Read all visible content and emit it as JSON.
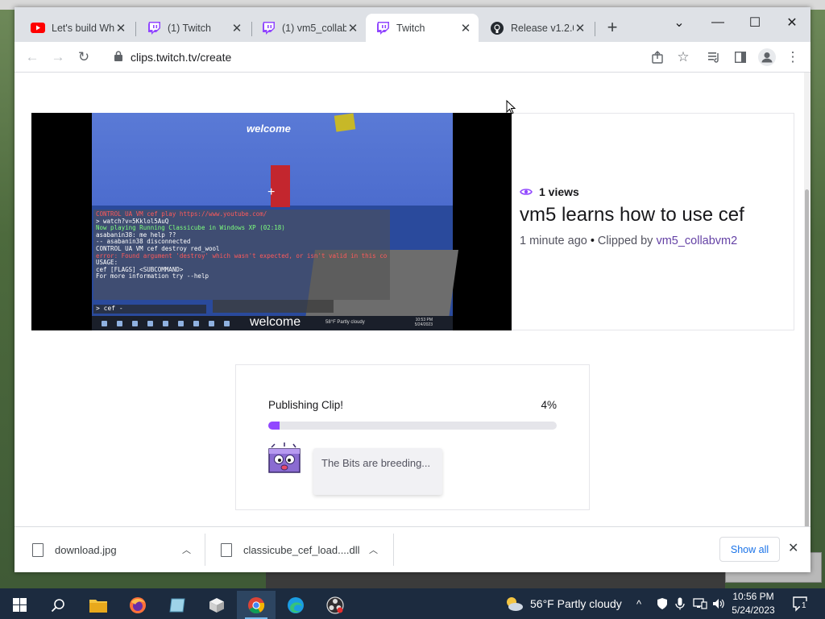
{
  "browser": {
    "tabs": [
      {
        "label": "Let's build Wh",
        "favicon": "youtube-icon",
        "active": false
      },
      {
        "label": "(1) Twitch",
        "favicon": "twitch-icon",
        "active": false
      },
      {
        "label": "(1) vm5_collab",
        "favicon": "twitch-icon",
        "active": false
      },
      {
        "label": "Twitch",
        "favicon": "twitch-icon",
        "active": true
      },
      {
        "label": "Release v1.2.0",
        "favicon": "github-icon",
        "active": false
      }
    ],
    "url": "clips.twitch.tv/create"
  },
  "clip": {
    "views": "1 views",
    "title": "vm5 learns how to use cef",
    "time_ago": "1 minute ago",
    "clipped_by_label": "Clipped by",
    "clipped_by_user": "vm5_collabvm2"
  },
  "video": {
    "welcome_top": "welcome",
    "welcome_bottom": "welcome",
    "chat_lines": [
      {
        "text": "CONTROL UA VM cef play https://www.youtube.com/",
        "cls": ""
      },
      {
        "text": "> watch?v=5Kklol5AuQ",
        "cls": ""
      },
      {
        "text": "Now playing Running Classicube in Windows XP (02:18)",
        "cls": "green"
      },
      {
        "text": "asabanin38: me help ??",
        "cls": ""
      },
      {
        "text": "-- asabanin38 disconnected",
        "cls": ""
      },
      {
        "text": "CONTROL UA VM cef destroy red_wool",
        "cls": ""
      },
      {
        "text": "error: Found argument 'destroy' which wasn't expected, or isn't valid in this context",
        "cls": "red"
      },
      {
        "text": "",
        "cls": ""
      },
      {
        "text": "USAGE:",
        "cls": ""
      },
      {
        "text": "    cef [FLAGS] <SUBCOMMAND>",
        "cls": ""
      },
      {
        "text": "",
        "cls": ""
      },
      {
        "text": "For more information try --help",
        "cls": ""
      }
    ],
    "command": "> cef -",
    "weather": "58°F Partly cloudy",
    "clock_time": "10:53 PM",
    "clock_date": "5/24/2023"
  },
  "publish": {
    "label": "Publishing Clip!",
    "percent_text": "4%",
    "progress": 0.04,
    "message": "The Bits are breeding..."
  },
  "downloads": [
    {
      "name": "download.jpg"
    },
    {
      "name": "classicube_cef_load....dll"
    }
  ],
  "shelf": {
    "show_all": "Show all"
  },
  "taskbar": {
    "weather": "56°F  Partly cloudy",
    "time": "10:56 PM",
    "date": "5/24/2023",
    "notifications": "1"
  },
  "colors": {
    "twitch_purple": "#9147ff",
    "link_purple": "#6441a5",
    "taskbar": "#1c2b3f"
  }
}
